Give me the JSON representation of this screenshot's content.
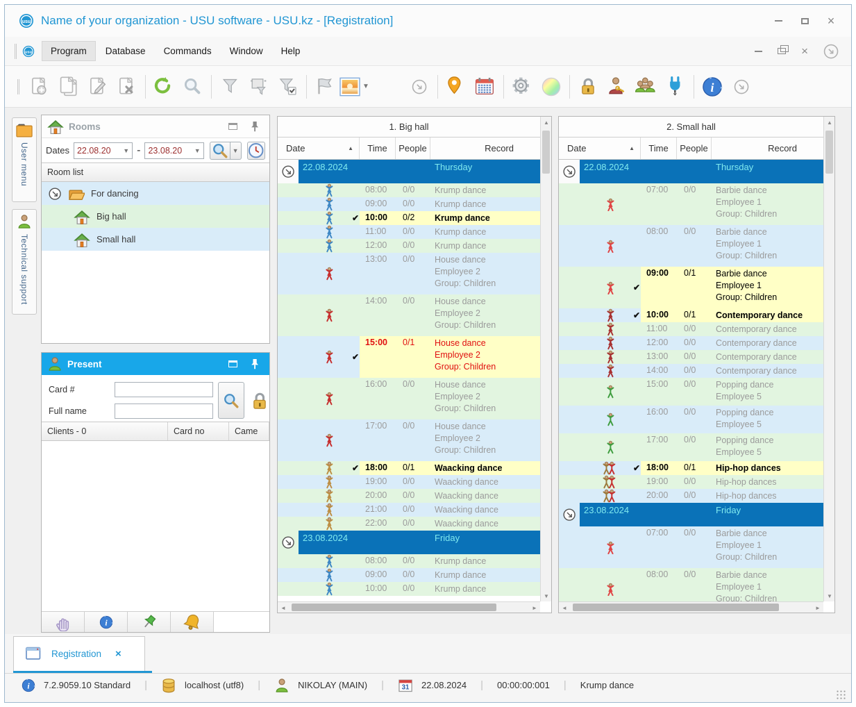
{
  "window": {
    "title": "Name of your organization - USU software - USU.kz - [Registration]",
    "controls": {
      "close_glyph": "×"
    }
  },
  "menu": {
    "items": [
      "Program",
      "Database",
      "Commands",
      "Window",
      "Help"
    ],
    "active": "Program"
  },
  "toolbar": {
    "items": [
      {
        "icon": "new-record-icon"
      },
      {
        "icon": "copy-record-icon"
      },
      {
        "icon": "edit-record-icon"
      },
      {
        "icon": "delete-record-icon"
      },
      "sep",
      {
        "icon": "refresh-icon"
      },
      {
        "icon": "search-icon"
      },
      "sep",
      {
        "icon": "filter-icon"
      },
      {
        "icon": "filter-columns-icon"
      },
      {
        "icon": "filter-apply-icon"
      },
      "sep",
      {
        "icon": "flag-icon"
      },
      {
        "icon": "image-preview-icon",
        "dropdown": true
      },
      "gap",
      {
        "icon": "overflow-icon"
      },
      "sep",
      {
        "icon": "map-pin-icon"
      },
      {
        "icon": "calendar-icon"
      },
      "sep",
      {
        "icon": "settings-gear-icon"
      },
      {
        "icon": "color-palette-icon"
      },
      "sep",
      {
        "icon": "lock-icon"
      },
      {
        "icon": "user-key-icon"
      },
      {
        "icon": "user-group-icon"
      },
      {
        "icon": "plugin-icon"
      },
      "sep",
      {
        "icon": "info-icon"
      },
      {
        "icon": "overflow-icon"
      }
    ]
  },
  "side_tabs": [
    {
      "icon": "folder-icon",
      "label": "User menu"
    },
    {
      "icon": "person-icon",
      "label": "Technical support"
    }
  ],
  "rooms_panel": {
    "title": "Rooms",
    "dates_label": "Dates",
    "date_from": "22.08.20",
    "date_to": "23.08.20",
    "range_separator": "-",
    "list_header": "Room list",
    "tree": [
      {
        "label": "For dancing",
        "level": 0,
        "icon": "folder-open-icon",
        "expander": true,
        "bg": "blue"
      },
      {
        "label": "Big hall",
        "level": 1,
        "icon": "house-icon",
        "bg": "green"
      },
      {
        "label": "Small hall",
        "level": 1,
        "icon": "house-icon",
        "bg": "blue"
      }
    ]
  },
  "present_panel": {
    "title": "Present",
    "card_label": "Card #",
    "name_label": "Full name",
    "card_value": "",
    "name_value": "",
    "table_headers": [
      "Clients - 0",
      "Card no",
      "Came"
    ],
    "buttons": [
      "hand-icon",
      "info-icon",
      "pushpin-icon",
      "bell-icon"
    ]
  },
  "halls": [
    {
      "title": "1. Big hall",
      "columns": {
        "date": "Date",
        "time": "Time",
        "people": "People",
        "record": "Record"
      },
      "rows": [
        {
          "type": "group",
          "date": "22.08.2024",
          "day": "Thursday"
        },
        {
          "type": "session",
          "icon": "krump-dancer-icon",
          "time": "08:00",
          "people": "0/0",
          "record": [
            "Krump dance"
          ],
          "bg": "green"
        },
        {
          "type": "session",
          "icon": "krump-dancer-icon",
          "time": "09:00",
          "people": "0/0",
          "record": [
            "Krump dance"
          ],
          "bg": "blue"
        },
        {
          "type": "session",
          "icon": "krump-dancer-icon",
          "checked": true,
          "time": "10:00",
          "people": "0/2",
          "record": [
            "Krump dance"
          ],
          "bg": "green"
        },
        {
          "type": "session",
          "icon": "krump-dancer-icon",
          "time": "11:00",
          "people": "0/0",
          "record": [
            "Krump dance"
          ],
          "bg": "blue"
        },
        {
          "type": "session",
          "icon": "krump-dancer-icon",
          "time": "12:00",
          "people": "0/0",
          "record": [
            "Krump dance"
          ],
          "bg": "green"
        },
        {
          "type": "session",
          "icon": "house-dancer-icon",
          "time": "13:00",
          "people": "0/0",
          "record": [
            "House dance",
            "Employee 2",
            "Group: Children"
          ],
          "bg": "blue"
        },
        {
          "type": "session",
          "icon": "house-dancer-icon",
          "time": "14:00",
          "people": "0/0",
          "record": [
            "House dance",
            "Employee 2",
            "Group: Children"
          ],
          "bg": "green"
        },
        {
          "type": "session",
          "icon": "house-dancer-icon",
          "checked": true,
          "red": true,
          "time": "15:00",
          "people": "0/1",
          "record": [
            "House dance",
            "Employee 2",
            "Group: Children"
          ],
          "bg": "blue"
        },
        {
          "type": "session",
          "icon": "house-dancer-icon",
          "time": "16:00",
          "people": "0/0",
          "record": [
            "House dance",
            "Employee 2",
            "Group: Children"
          ],
          "bg": "green"
        },
        {
          "type": "session",
          "icon": "house-dancer-icon",
          "time": "17:00",
          "people": "0/0",
          "record": [
            "House dance",
            "Employee 2",
            "Group: Children"
          ],
          "bg": "blue"
        },
        {
          "type": "session",
          "icon": "waacking-dancer-icon",
          "checked": true,
          "time": "18:00",
          "people": "0/1",
          "record": [
            "Waacking dance"
          ],
          "bg": "green"
        },
        {
          "type": "session",
          "icon": "waacking-dancer-icon",
          "time": "19:00",
          "people": "0/0",
          "record": [
            "Waacking dance"
          ],
          "bg": "blue"
        },
        {
          "type": "session",
          "icon": "waacking-dancer-icon",
          "time": "20:00",
          "people": "0/0",
          "record": [
            "Waacking dance"
          ],
          "bg": "green"
        },
        {
          "type": "session",
          "icon": "waacking-dancer-icon",
          "time": "21:00",
          "people": "0/0",
          "record": [
            "Waacking dance"
          ],
          "bg": "blue"
        },
        {
          "type": "session",
          "icon": "waacking-dancer-icon",
          "time": "22:00",
          "people": "0/0",
          "record": [
            "Waacking dance"
          ],
          "bg": "green"
        },
        {
          "type": "group",
          "date": "23.08.2024",
          "day": "Friday"
        },
        {
          "type": "session",
          "icon": "krump-dancer-icon",
          "time": "08:00",
          "people": "0/0",
          "record": [
            "Krump dance"
          ],
          "bg": "green"
        },
        {
          "type": "session",
          "icon": "krump-dancer-icon",
          "time": "09:00",
          "people": "0/0",
          "record": [
            "Krump dance"
          ],
          "bg": "blue"
        },
        {
          "type": "session",
          "icon": "krump-dancer-icon",
          "time": "10:00",
          "people": "0/0",
          "record": [
            "Krump dance"
          ],
          "bg": "green"
        }
      ]
    },
    {
      "title": "2. Small hall",
      "columns": {
        "date": "Date",
        "time": "Time",
        "people": "People",
        "record": "Record"
      },
      "rows": [
        {
          "type": "group",
          "date": "22.08.2024",
          "day": "Thursday"
        },
        {
          "type": "session",
          "icon": "barbie-dancer-icon",
          "time": "07:00",
          "people": "0/0",
          "record": [
            "Barbie dance",
            "Employee 1",
            "Group: Children"
          ],
          "bg": "green"
        },
        {
          "type": "session",
          "icon": "barbie-dancer-icon",
          "time": "08:00",
          "people": "0/0",
          "record": [
            "Barbie dance",
            "Employee 1",
            "Group: Children"
          ],
          "bg": "blue"
        },
        {
          "type": "session",
          "icon": "barbie-dancer-icon",
          "checked": true,
          "time": "09:00",
          "people": "0/1",
          "record": [
            "Barbie dance",
            "Employee 1",
            "Group: Children"
          ],
          "bg": "green"
        },
        {
          "type": "session",
          "icon": "contemporary-dancer-icon",
          "checked": true,
          "time": "10:00",
          "people": "0/1",
          "record": [
            "Contemporary dance"
          ],
          "bg": "blue"
        },
        {
          "type": "session",
          "icon": "contemporary-dancer-icon",
          "time": "11:00",
          "people": "0/0",
          "record": [
            "Contemporary dance"
          ],
          "bg": "green"
        },
        {
          "type": "session",
          "icon": "contemporary-dancer-icon",
          "time": "12:00",
          "people": "0/0",
          "record": [
            "Contemporary dance"
          ],
          "bg": "blue"
        },
        {
          "type": "session",
          "icon": "contemporary-dancer-icon",
          "time": "13:00",
          "people": "0/0",
          "record": [
            "Contemporary dance"
          ],
          "bg": "green"
        },
        {
          "type": "session",
          "icon": "contemporary-dancer-icon",
          "time": "14:00",
          "people": "0/0",
          "record": [
            "Contemporary dance"
          ],
          "bg": "blue"
        },
        {
          "type": "session",
          "icon": "popping-dancer-icon",
          "time": "15:00",
          "people": "0/0",
          "record": [
            "Popping dance",
            "Employee 5"
          ],
          "bg": "green"
        },
        {
          "type": "session",
          "icon": "popping-dancer-icon",
          "time": "16:00",
          "people": "0/0",
          "record": [
            "Popping dance",
            "Employee 5"
          ],
          "bg": "blue"
        },
        {
          "type": "session",
          "icon": "popping-dancer-icon",
          "time": "17:00",
          "people": "0/0",
          "record": [
            "Popping dance",
            "Employee 5"
          ],
          "bg": "green"
        },
        {
          "type": "session",
          "icon": "hiphop-dancers-icon",
          "checked": true,
          "time": "18:00",
          "people": "0/1",
          "record": [
            "Hip-hop dances"
          ],
          "bg": "blue"
        },
        {
          "type": "session",
          "icon": "hiphop-dancers-icon",
          "time": "19:00",
          "people": "0/0",
          "record": [
            "Hip-hop dances"
          ],
          "bg": "green"
        },
        {
          "type": "session",
          "icon": "hiphop-dancers-icon",
          "time": "20:00",
          "people": "0/0",
          "record": [
            "Hip-hop dances"
          ],
          "bg": "blue"
        },
        {
          "type": "group",
          "date": "23.08.2024",
          "day": "Friday"
        },
        {
          "type": "session",
          "icon": "barbie-dancer-icon",
          "time": "07:00",
          "people": "0/0",
          "record": [
            "Barbie dance",
            "Employee 1",
            "Group: Children"
          ],
          "bg": "blue"
        },
        {
          "type": "session",
          "icon": "barbie-dancer-icon",
          "time": "08:00",
          "people": "0/0",
          "record": [
            "Barbie dance",
            "Employee 1",
            "Group: Children"
          ],
          "bg": "green"
        }
      ]
    }
  ],
  "bottom_tab": {
    "label": "Registration",
    "close_glyph": "×"
  },
  "status_bar": {
    "items": [
      {
        "icon": "info-icon",
        "text": "7.2.9059.10 Standard"
      },
      {
        "icon": "database-icon",
        "text": "localhost (utf8)"
      },
      {
        "icon": "user-icon",
        "text": "NIKOLAY (MAIN)"
      },
      {
        "icon": "calendar-31-icon",
        "text": "22.08.2024"
      },
      {
        "icon": null,
        "text": "00:00:00:001"
      },
      {
        "icon": null,
        "text": "Krump dance"
      }
    ]
  },
  "colors": {
    "accent_blue": "#2196d3",
    "group_row_bg": "#0a72b8",
    "group_row_text": "#7fe9ef",
    "row_green": "#e2f5e0",
    "row_blue": "#d9ecf9",
    "highlight_yellow": "#ffffc6",
    "present_header": "#18a7e9",
    "red_text": "#e01010",
    "muted_text": "#9b9b9b"
  }
}
